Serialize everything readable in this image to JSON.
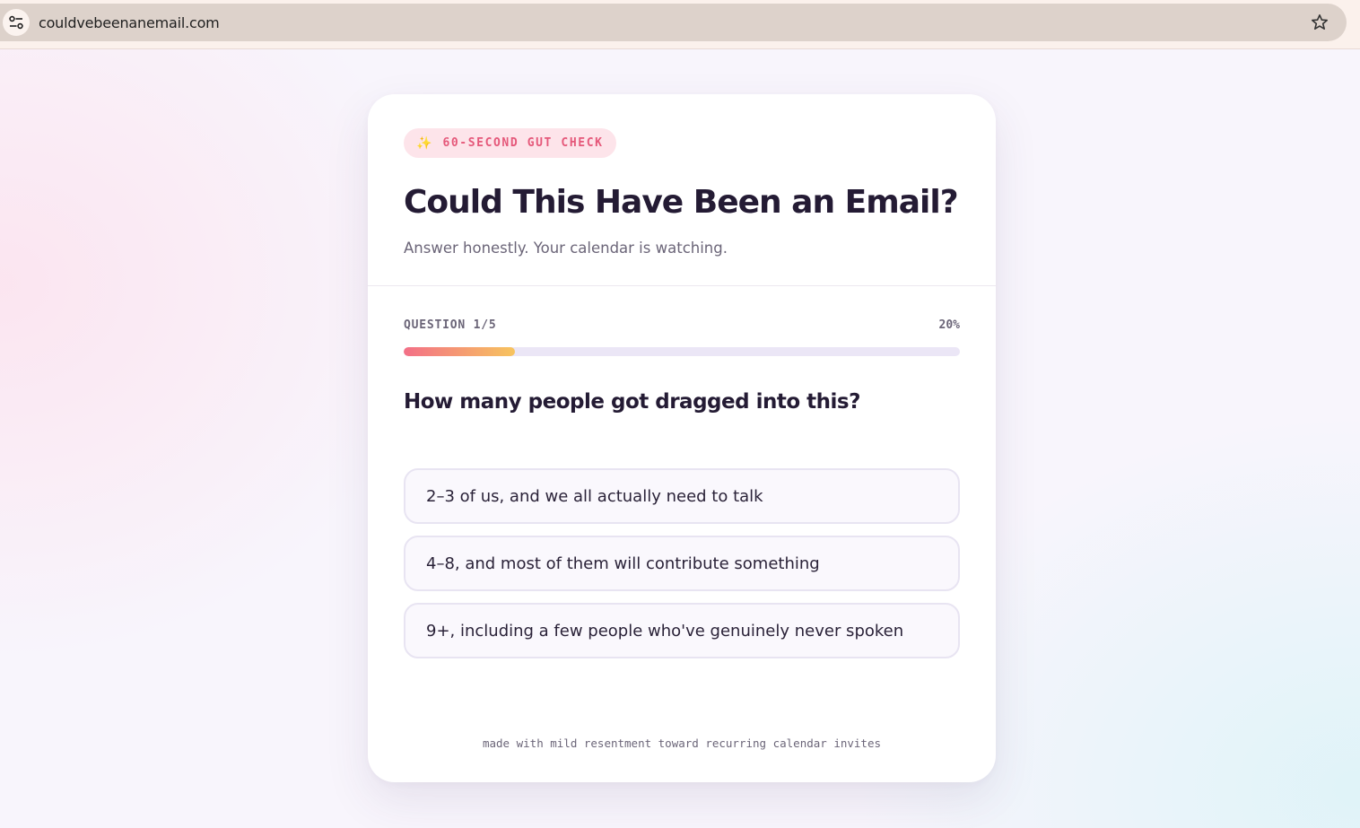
{
  "browser": {
    "url": "couldvebeenanemail.com",
    "site_info_icon": "tune-icon",
    "bookmark_icon": "star-icon"
  },
  "badge": {
    "icon": "sparkles-icon",
    "glyph": "✨",
    "label": "60-SECOND GUT CHECK"
  },
  "header": {
    "title": "Could This Have Been an Email?",
    "subtitle": "Answer honestly. Your calendar is watching."
  },
  "progress": {
    "label": "QUESTION 1/5",
    "percent_text": "20%",
    "value": 0.2
  },
  "question": {
    "text": "How many people got dragged into this?",
    "options": [
      "2–3 of us, and we all actually need to talk",
      "4–8, and most of them will contribute something",
      "9+, including a few people who've genuinely never spoken"
    ]
  },
  "footer": {
    "text": "made with mild resentment toward recurring calendar invites"
  },
  "colors": {
    "accent_pink": "#e5587a",
    "progress_start": "#f36f87",
    "progress_end": "#f7c45e",
    "heading": "#241b34"
  }
}
